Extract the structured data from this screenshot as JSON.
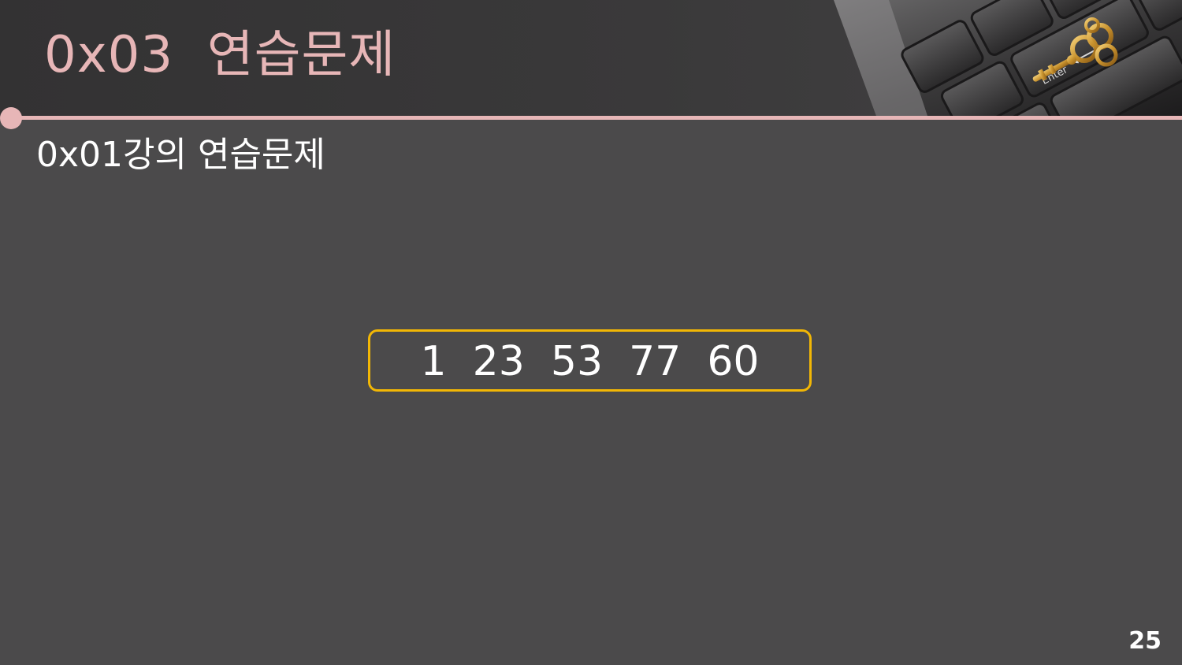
{
  "slide": {
    "title": "0x03  연습문제",
    "subtitle": "0x01강의 연습문제",
    "answer": "1  23  53  77  60",
    "page_number": "25",
    "key_label": "Enter"
  },
  "colors": {
    "accent_pink": "#e7b6b7",
    "answer_border": "#f2b705",
    "background": "#4b4a4b",
    "header_band": "#333233",
    "text_white": "#ffffff"
  },
  "icons": {
    "header_image": "keyboard-with-golden-key"
  }
}
